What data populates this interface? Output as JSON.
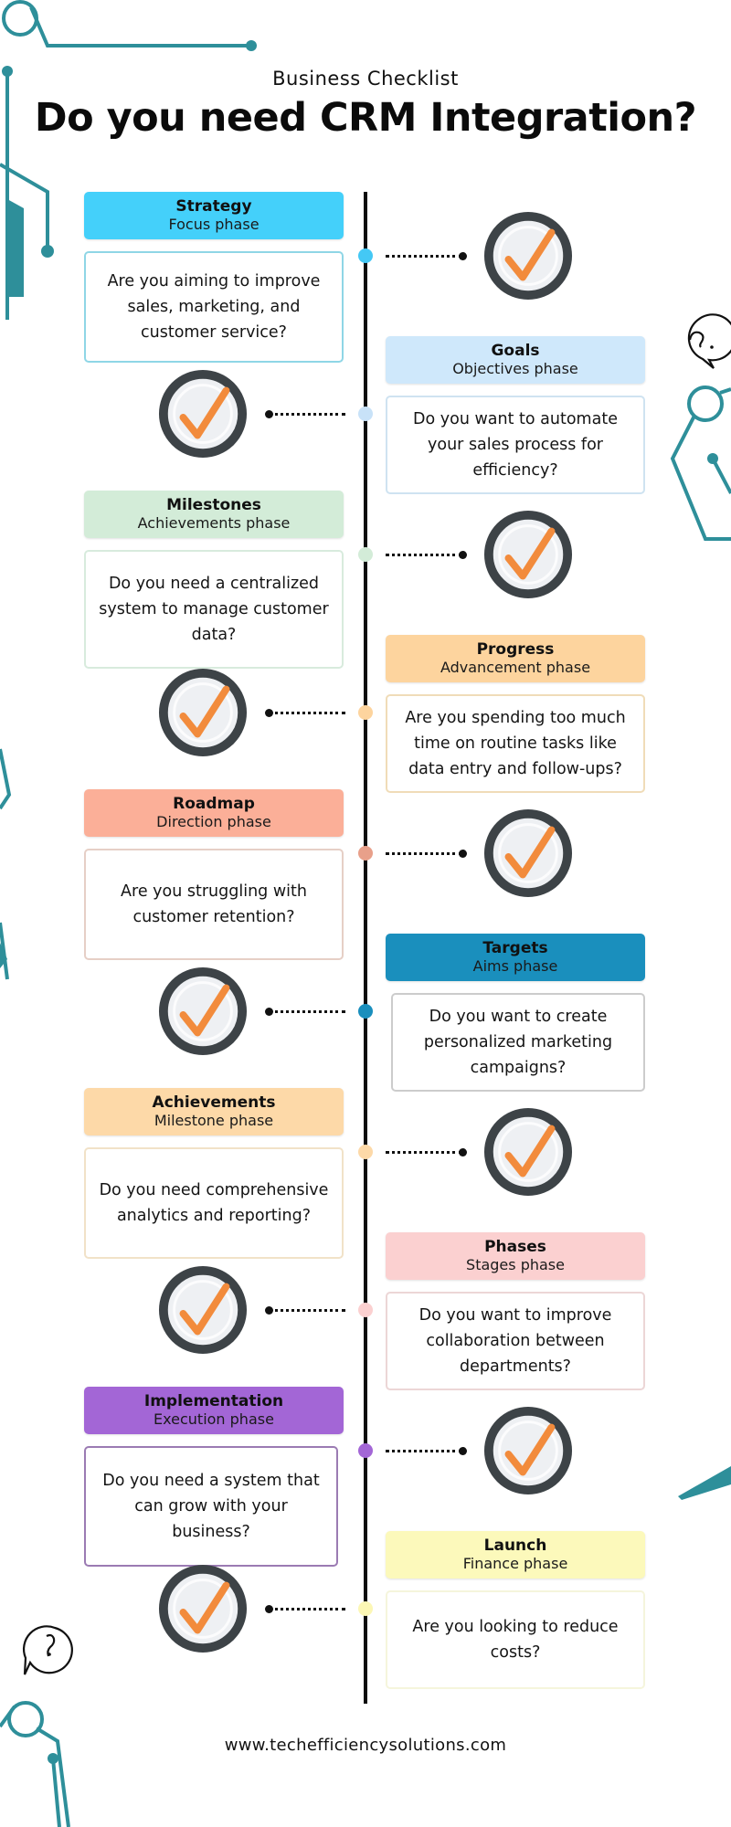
{
  "header": {
    "subtitle": "Business Checklist",
    "title": "Do you need CRM Integration?"
  },
  "icons": {
    "check": "checkmark-badge-icon",
    "speech_question": "question-speech-bubble-icon",
    "circuit": "circuit-line-decoration"
  },
  "colors": {
    "spine": "#0b0b0b",
    "check_ring": "#3d4347",
    "check_mark": "#f28b3c",
    "decoration": "#2e8f9a"
  },
  "items": [
    {
      "title": "Strategy",
      "phase": "Focus phase",
      "question": "Are you aiming to improve sales, marketing, and customer service?",
      "side": "left",
      "header_color": "#44d0fa",
      "border_color": "#8fd6e6",
      "dot_color": "#44c8f5"
    },
    {
      "title": "Goals",
      "phase": "Objectives phase",
      "question": "Do you want to automate your sales process for efficiency?",
      "side": "right",
      "header_color": "#cfe8fb",
      "border_color": "#cfe3f1",
      "dot_color": "#c8e2f8"
    },
    {
      "title": "Milestones",
      "phase": "Achievements phase",
      "question": "Do you need a centralized system to manage customer data?",
      "side": "left",
      "header_color": "#d3ecd8",
      "border_color": "#d8ebdd",
      "dot_color": "#d3ecd8"
    },
    {
      "title": "Progress",
      "phase": "Advancement phase",
      "question": "Are you spending too much time on routine tasks like data entry and follow-ups?",
      "side": "right",
      "header_color": "#fdd49e",
      "border_color": "#f0dcb8",
      "dot_color": "#fdd49e"
    },
    {
      "title": "Roadmap",
      "phase": "Direction phase",
      "question": "Are you struggling with customer retention?",
      "side": "left",
      "header_color": "#fbaf98",
      "border_color": "#e6cfc6",
      "dot_color": "#e8a08a"
    },
    {
      "title": "Targets",
      "phase": "Aims phase",
      "question": "Do you want to create personalized marketing campaigns?",
      "side": "right",
      "header_color": "#1a8fbd",
      "border_color": "#cccccc",
      "dot_color": "#1a8fbd"
    },
    {
      "title": "Achievements",
      "phase": "Milestone phase",
      "question": "Do you need comprehensive analytics and reporting?",
      "side": "left",
      "header_color": "#fdd9a8",
      "border_color": "#f1e2c8",
      "dot_color": "#fdd9a8"
    },
    {
      "title": "Phases",
      "phase": "Stages phase",
      "question": "Do you want to improve collaboration between departments?",
      "side": "right",
      "header_color": "#fbd0d0",
      "border_color": "#ecd6d6",
      "dot_color": "#fbd0d0"
    },
    {
      "title": "Implementation",
      "phase": "Execution phase",
      "question": "Do you need a system that can grow with your business?",
      "side": "left",
      "header_color": "#a366d6",
      "border_color": "#9b7bb3",
      "dot_color": "#a366d6"
    },
    {
      "title": "Launch",
      "phase": "Finance phase",
      "question": "Are you looking to reduce costs?",
      "side": "right",
      "header_color": "#fcf9bb",
      "border_color": "#f5f5dc",
      "dot_color": "#fcf7b5"
    }
  ],
  "footer": {
    "website": "www.techefficiencysolutions.com"
  }
}
